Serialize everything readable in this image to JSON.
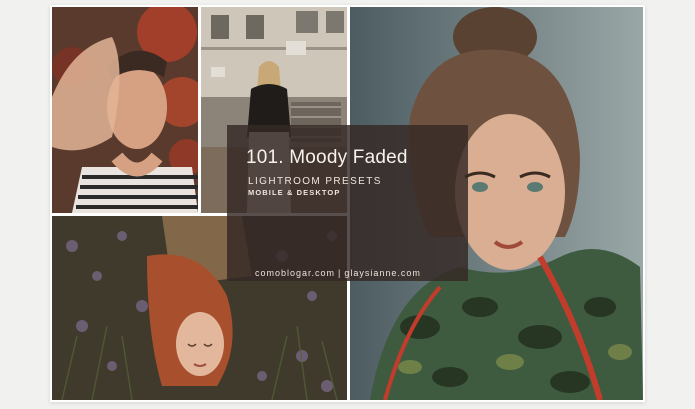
{
  "overlay": {
    "title": "101. Moody Faded",
    "subtitle": "LIGHTROOM PRESETS",
    "tagline": "MOBILE & DESKTOP",
    "credit_left": "comoblogar.com",
    "credit_separator": "|",
    "credit_right": "glaysianne.com"
  },
  "colors": {
    "background": "#f1f1f0",
    "overlay": "#342824",
    "text": "#f3ece6"
  }
}
